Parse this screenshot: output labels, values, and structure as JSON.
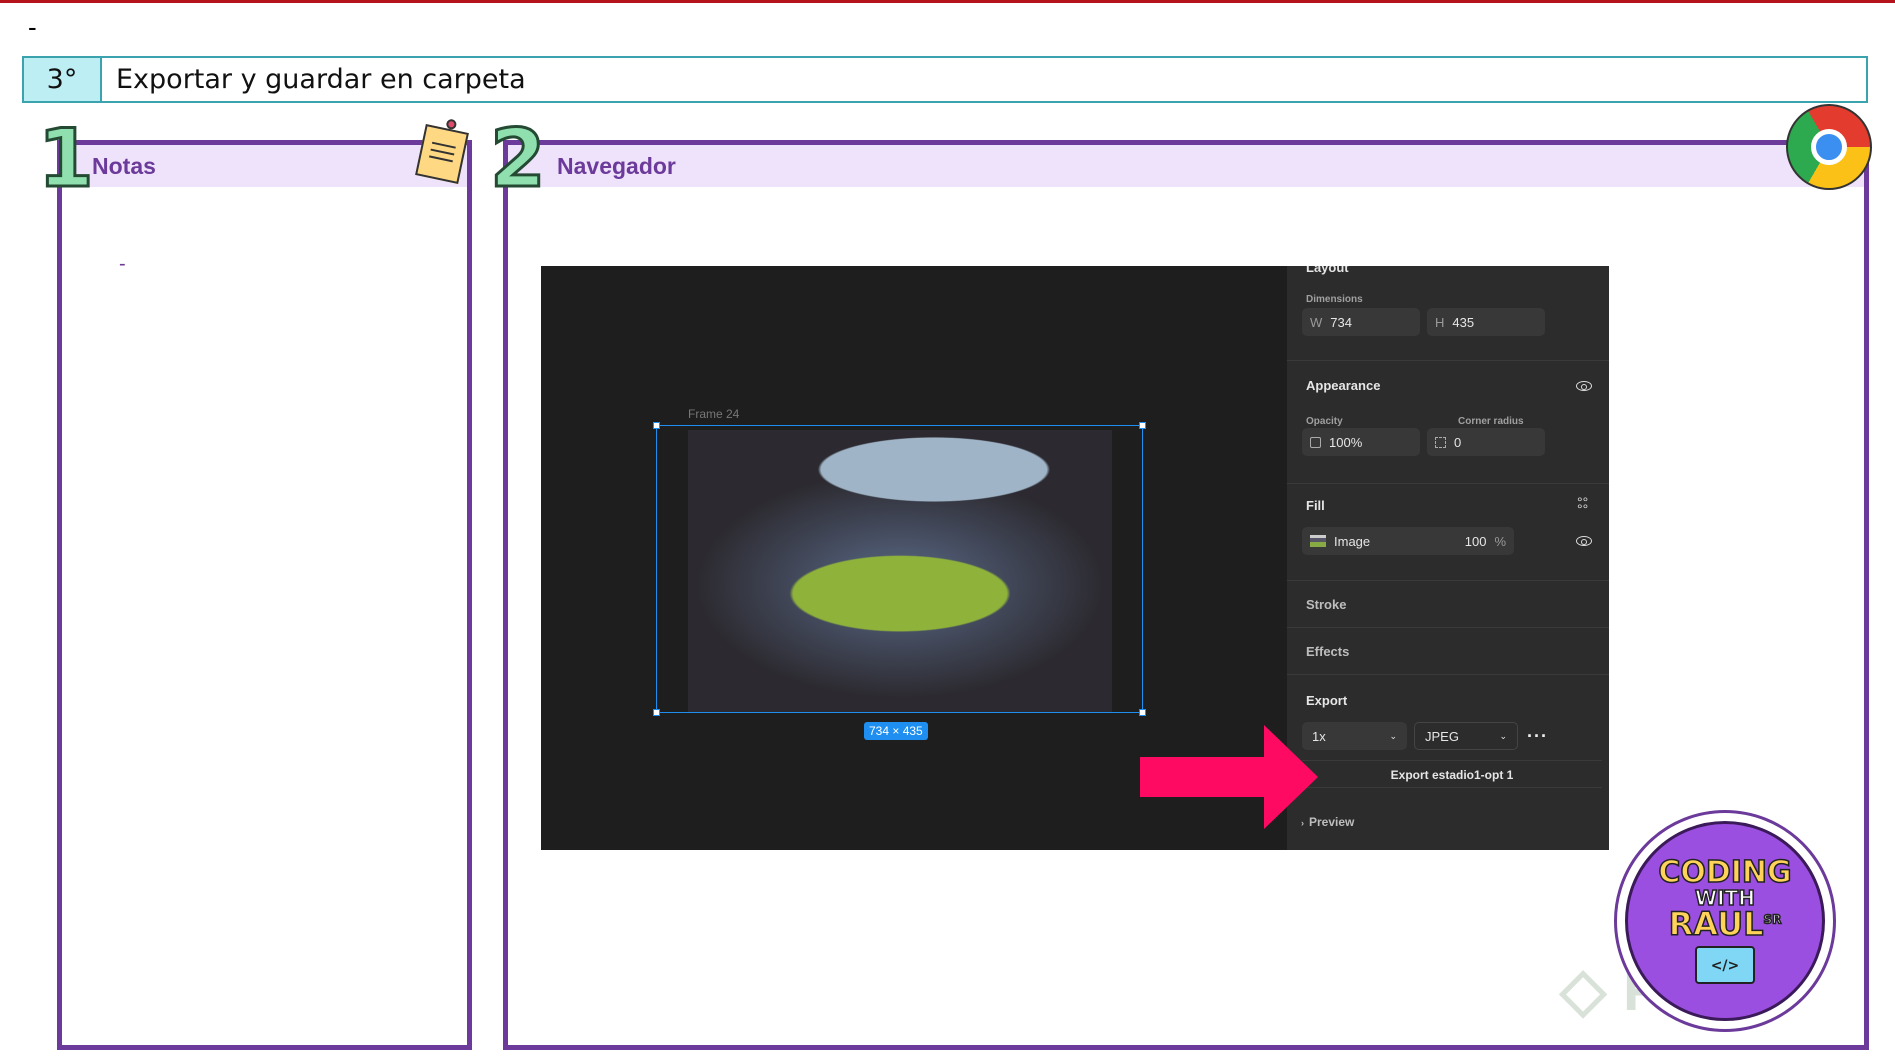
{
  "page": {
    "top_dash": "-"
  },
  "step": {
    "number": "3°",
    "title": "Exportar y guardar en carpeta"
  },
  "notes": {
    "index": "1",
    "title": "Notas",
    "bullet": "-"
  },
  "browser": {
    "index": "2",
    "title": "Navegador"
  },
  "canvas": {
    "frame_label": "Frame 24",
    "size_badge": "734 × 435"
  },
  "properties": {
    "layout_title": "Layout",
    "dimensions_label": "Dimensions",
    "width_key": "W",
    "width": "734",
    "height_key": "H",
    "height": "435",
    "appearance_title": "Appearance",
    "opacity_label": "Opacity",
    "opacity": "100%",
    "corner_label": "Corner radius",
    "corner": "0",
    "fill_title": "Fill",
    "fill_type": "Image",
    "fill_opacity": "100",
    "fill_unit": "%",
    "stroke_title": "Stroke",
    "effects_title": "Effects",
    "export_title": "Export",
    "export_scale": "1x",
    "export_format": "JPEG",
    "export_button": "Export estadio1-opt 1",
    "preview": "Preview"
  },
  "colors": {
    "accent_purple": "#6b3a9a",
    "arrow": "#ff0a62",
    "selection": "#1e8ff0"
  },
  "branding": {
    "logo_text": "CODING WITH RAUL SR",
    "watermark": "Platzi"
  }
}
